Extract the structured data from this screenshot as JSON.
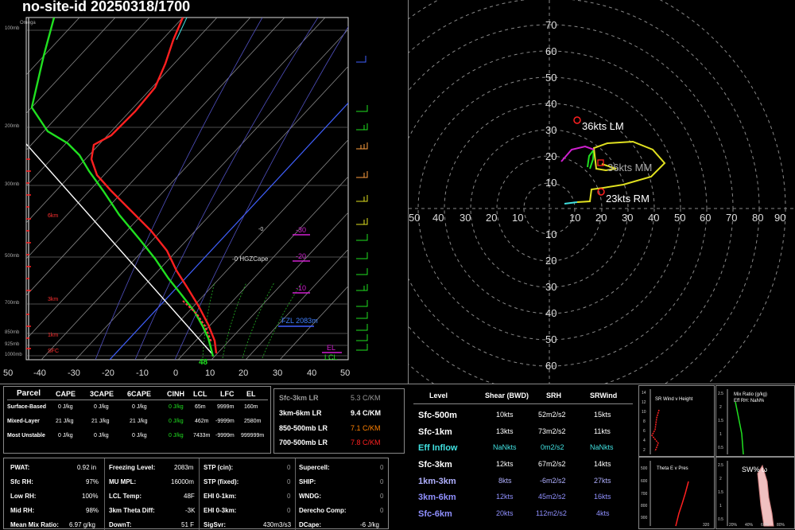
{
  "title": "no-site-id 20250318/1700",
  "skewt": {
    "pressure_labels": [
      "100mb",
      "200mb",
      "300mb",
      "500mb",
      "700mb",
      "850mb",
      "925mb",
      "1000mb"
    ],
    "height_labels": [
      "6km",
      "3km",
      "1km",
      "SFC"
    ],
    "temp_ticks": [
      "50",
      "-40",
      "-30",
      "-20",
      "-10",
      "0",
      "10",
      "20",
      "30",
      "40",
      "50"
    ],
    "omega_label": "Omega",
    "annotations": {
      "zero_line": "-0",
      "hgz_cape": "-0 HGZCape",
      "neg30": "-30",
      "neg20": "-20",
      "neg10": "-10",
      "fzl": "FZL 2083m",
      "el": "EL",
      "lcl": "LCL",
      "sfc_temp": "48"
    }
  },
  "hodograph": {
    "axis_pos": [
      "10",
      "20",
      "30",
      "40",
      "50",
      "60",
      "70"
    ],
    "axis_neg": [
      "10",
      "20",
      "30",
      "40",
      "50",
      "60"
    ],
    "x_left": [
      "50",
      "40",
      "30",
      "20",
      "10"
    ],
    "x_right": [
      "10",
      "20",
      "30",
      "40",
      "50",
      "60",
      "70",
      "80",
      "90"
    ],
    "lm_label": "36kts LM",
    "mm_label": "36kts MM",
    "rm_label": "23kts RM"
  },
  "parcel_table": {
    "headers": [
      "Parcel",
      "CAPE",
      "3CAPE",
      "6CAPE",
      "CINH",
      "LCL",
      "LFC",
      "EL"
    ],
    "rows": [
      [
        "Surface-Based",
        "0 J/kg",
        "0 J/kg",
        "0 J/kg",
        "0 J/kg",
        "65m",
        "9999m",
        "160m"
      ],
      [
        "Mixed-Layer",
        "21 J/kg",
        "21 J/kg",
        "21 J/kg",
        "0 J/kg",
        "462m",
        "-9999m",
        "2580m"
      ],
      [
        "Most Unstable",
        "0 J/kg",
        "0 J/kg",
        "0 J/kg",
        "0 J/kg",
        "7433m",
        "-9999m",
        "999999m"
      ]
    ]
  },
  "lapse_rates": [
    {
      "label": "Sfc-3km LR",
      "value": "5.3 C/KM",
      "color": "#999999"
    },
    {
      "label": "3km-6km LR",
      "value": "9.4 C/KM",
      "color": "#ffffff"
    },
    {
      "label": "850-500mb LR",
      "value": "7.1 C/KM",
      "color": "#ff8000"
    },
    {
      "label": "700-500mb LR",
      "value": "7.8 C/KM",
      "color": "#ff2020"
    }
  ],
  "params1": [
    {
      "label": "PWAT:",
      "value": "0.92 in"
    },
    {
      "label": "Sfc RH:",
      "value": "97%"
    },
    {
      "label": "Low RH:",
      "value": "100%"
    },
    {
      "label": "Mid RH:",
      "value": "98%"
    },
    {
      "label": "Mean Mix Ratio:",
      "value": "6.97 g/kg"
    }
  ],
  "params2": [
    {
      "label": "Freezing Level:",
      "value": "2083m"
    },
    {
      "label": "MU MPL:",
      "value": "16000m"
    },
    {
      "label": "LCL Temp:",
      "value": "48F"
    },
    {
      "label": "3km Theta Diff:",
      "value": "-3K"
    },
    {
      "label": "DownT:",
      "value": "51 F"
    }
  ],
  "params3": [
    {
      "label": "STP (cin):",
      "value": "0"
    },
    {
      "label": "STP (fixed):",
      "value": "0"
    },
    {
      "label": "EHI 0-1km:",
      "value": "0"
    },
    {
      "label": "EHI 0-3km:",
      "value": "0"
    },
    {
      "label": "SigSvr:",
      "value": "430m3/s3"
    }
  ],
  "params4": [
    {
      "label": "Supercell:",
      "value": "0"
    },
    {
      "label": "SHIP:",
      "value": "0"
    },
    {
      "label": "WNDG:",
      "value": "0"
    },
    {
      "label": "Derecho Comp:",
      "value": "0"
    },
    {
      "label": "DCape:",
      "value": "-6 J/kg"
    }
  ],
  "shear_table": {
    "headers": [
      "Level",
      "Shear (BWD)",
      "SRH",
      "SRWind"
    ],
    "rows": [
      {
        "level": "Sfc-500m",
        "shear": "10kts",
        "srh": "52m2/s2",
        "srw": "15kts",
        "color": "#ffffff"
      },
      {
        "level": "Sfc-1km",
        "shear": "13kts",
        "srh": "73m2/s2",
        "srw": "11kts",
        "color": "#ffffff"
      },
      {
        "level": "Eff Inflow",
        "shear": "NaNkts",
        "srh": "0m2/s2",
        "srw": "NaNkts",
        "color": "#40e0e0"
      },
      {
        "level": "Sfc-3km",
        "shear": "12kts",
        "srh": "67m2/s2",
        "srw": "14kts",
        "color": "#ffffff"
      },
      {
        "level": "1km-3km",
        "shear": "8kts",
        "srh": "-6m2/s2",
        "srw": "27kts",
        "color": "#b0b0ff"
      },
      {
        "level": "3km-6km",
        "shear": "12kts",
        "srh": "45m2/s2",
        "srw": "16kts",
        "color": "#9090ff"
      },
      {
        "level": "Sfc-6km",
        "shear": "20kts",
        "srh": "112m2/s2",
        "srw": "4kts",
        "color": "#9090ff"
      }
    ]
  },
  "mini": {
    "srwind_title": "SR Wind  v  Height",
    "srwind_ticks": [
      "14",
      "12",
      "10",
      "8",
      "6",
      "4",
      "2"
    ],
    "mix_title": "Mix Ratio (g/kg)",
    "mix_sub": "Eff RH: NaN%",
    "mix_ticks": [
      "2.5",
      "2",
      "1.5",
      "1",
      "0.5"
    ],
    "theta_title": "Theta E  v  Pres",
    "theta_ticks": [
      "500",
      "600",
      "700",
      "800",
      "900"
    ],
    "theta_x": "320",
    "sw_title": "SW%  ω",
    "sw_ticks": [
      "2.5",
      "2",
      "1.5",
      "1",
      "0.5"
    ],
    "sw_x": [
      "20%",
      "40%",
      "60%",
      "80%"
    ]
  }
}
